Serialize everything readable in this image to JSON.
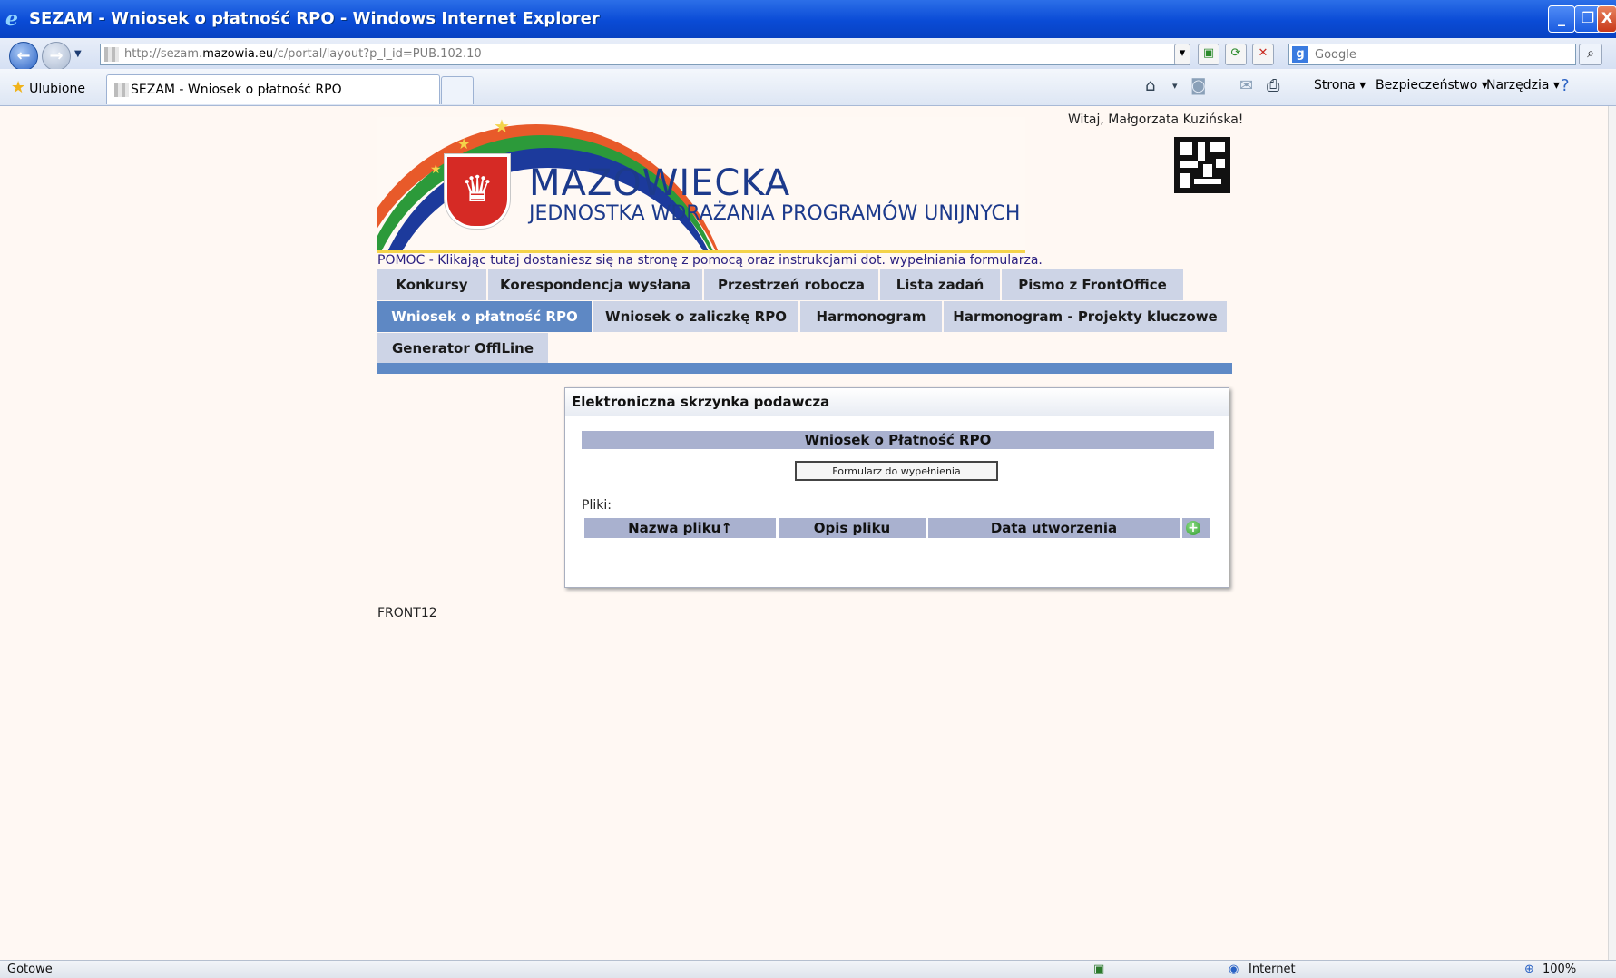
{
  "window": {
    "title": "SEZAM - Wniosek o płatność RPO - Windows Internet Explorer",
    "minimize_glyph": "_",
    "restore_glyph": "❐",
    "close_glyph": "X"
  },
  "address_bar": {
    "url_prefix": "http://sezam.",
    "url_domain": "mazowia.eu",
    "url_suffix": "/c/portal/layout?p_l_id=PUB.102.10"
  },
  "search": {
    "placeholder": "Google"
  },
  "favorites": {
    "label": "Ulubione"
  },
  "tab": {
    "title": "SEZAM - Wniosek o płatność RPO"
  },
  "command_bar": {
    "page": "Strona ▾",
    "security": "Bezpieczeństwo ▾",
    "tools": "Narzędzia ▾"
  },
  "page": {
    "greeting": "Witaj, Małgorzata Kuzińska!",
    "logo_title": "MAZOWIECKA",
    "logo_subtitle": "JEDNOSTKA WDRAŻANIA PROGRAMÓW UNIJNYCH",
    "help_text": "POMOC - Klikając tutaj dostaniesz się na stronę z pomocą oraz instrukcjami dot. wypełniania formularza.",
    "menu_row1": [
      "Konkursy",
      "Korespondencja wysłana",
      "Przestrzeń robocza",
      "Lista zadań",
      "Pismo z FrontOffice"
    ],
    "menu_row2": [
      "Wniosek o płatność RPO",
      "Wniosek o zaliczkę RPO",
      "Harmonogram",
      "Harmonogram - Projekty kluczowe"
    ],
    "menu_row3": [
      "Generator OfflLine"
    ],
    "active_menu": "Wniosek o płatność RPO",
    "footer_code": "FRONT12"
  },
  "panel": {
    "title": "Elektroniczna skrzynka podawcza",
    "section_title": "Wniosek o Płatność RPO",
    "form_button": "Formularz do wypełnienia",
    "files_label": "Pliki:",
    "columns": [
      "Nazwa pliku↑",
      "Opis pliku",
      "Data utworzenia"
    ],
    "add_icon": "add-file-icon"
  },
  "status": {
    "left": "Gotowe",
    "zone": "Internet",
    "zoom": "100%"
  },
  "colors": {
    "titlebar": "#0a4bd6",
    "menu_active": "#5e88c4",
    "menu_inactive": "#cdd4e6",
    "header_blue": "#a9b1cf",
    "page_bg": "#fff8f3"
  }
}
